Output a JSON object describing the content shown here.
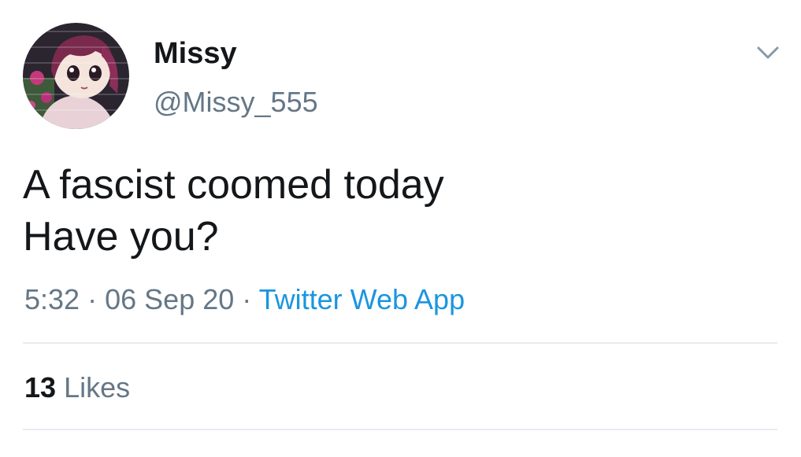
{
  "author": {
    "display_name": "Missy",
    "handle": "@Missy_555"
  },
  "tweet": {
    "lines": [
      "A fascist coomed today",
      "Have you?"
    ],
    "time": "5:32",
    "separator": "·",
    "date": "06 Sep 20",
    "source": "Twitter Web App"
  },
  "stats": {
    "likes_count": "13",
    "likes_label": "Likes"
  },
  "icons": {
    "menu": "chevron-down-icon",
    "avatar": "anime-avatar"
  },
  "colors": {
    "text": "#14171a",
    "secondary": "#657786",
    "link": "#1b95e0",
    "divider": "#e6ecf0"
  }
}
